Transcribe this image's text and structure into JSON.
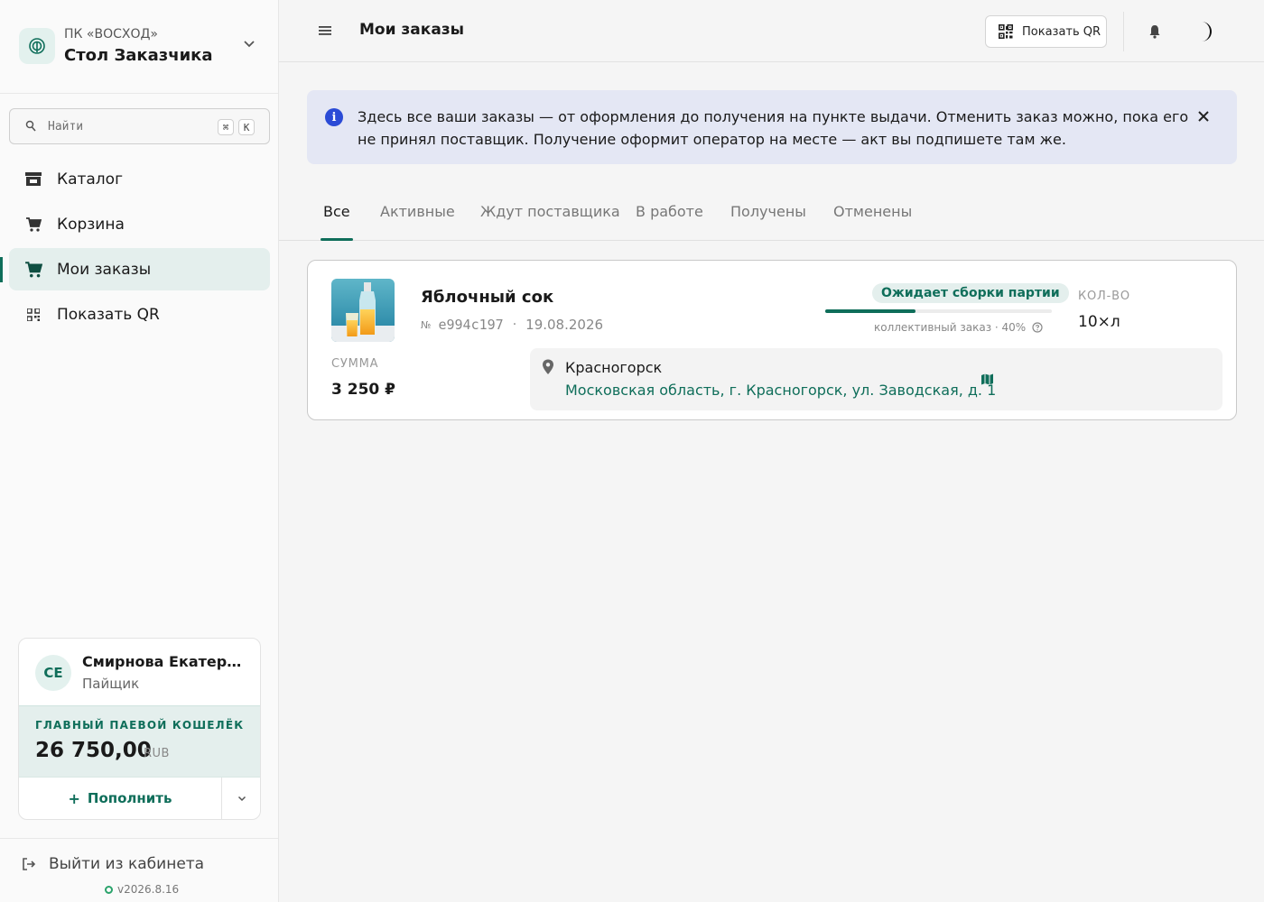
{
  "sidebar": {
    "brand": {
      "org": "ПК «ВОСХОД»",
      "name": "Стол Заказчика"
    },
    "search": {
      "placeholder": "Найти",
      "shortcut_mod": "⌘",
      "shortcut_key": "K"
    },
    "nav": [
      {
        "label": "Каталог",
        "icon": "store-icon",
        "active": false
      },
      {
        "label": "Корзина",
        "icon": "cart-icon",
        "active": false
      },
      {
        "label": "Мои заказы",
        "icon": "cart-icon",
        "active": true
      },
      {
        "label": "Показать QR",
        "icon": "qr-icon",
        "active": false
      }
    ],
    "user": {
      "initials": "СЕ",
      "name": "Смирнова Екатерина",
      "role": "Пайщик"
    },
    "wallet": {
      "title": "ГЛАВНЫЙ ПАЕВОЙ КОШЕЛЁК",
      "amount": "26 750,00",
      "currency": "RUB",
      "topup_label": "Пополнить"
    },
    "footer": {
      "logout_label": "Выйти из кабинета",
      "version": "v2026.8.16"
    }
  },
  "header": {
    "title": "Мои заказы",
    "qr_button_label": "Показать QR"
  },
  "banner": {
    "text": "Здесь все ваши заказы — от оформления до получения на пункте выдачи. Отменить заказ можно, пока его не принял поставщик. Получение оформит оператор на месте — акт вы подпишете там же."
  },
  "tabs": [
    {
      "label": "Все",
      "active": true
    },
    {
      "label": "Активные",
      "active": false
    },
    {
      "label": "Ждут поставщика",
      "active": false
    },
    {
      "label": "В работе",
      "active": false
    },
    {
      "label": "Получены",
      "active": false
    },
    {
      "label": "Отменены",
      "active": false
    }
  ],
  "orders": [
    {
      "product": "Яблочный сок",
      "number_sign": "№",
      "id": "e994c197",
      "separator": "·",
      "date": "19.08.2026",
      "status": "Ожидает сборки партии",
      "progress_percent": 40,
      "progress_note": "коллективный заказ · 40%",
      "qty_label": "КОЛ-ВО",
      "qty_value": "10×л",
      "sum_label": "СУММА",
      "sum_value": "3 250 ₽",
      "address_city": "Красногорск",
      "address_full": "Московская область, г. Красногорск, ул. Заводская, д. 1"
    }
  ],
  "colors": {
    "accent": "#0f6e5a",
    "accent_soft": "#e4efed",
    "info": "#2b4bd6",
    "info_bg": "#e4e7f4"
  }
}
